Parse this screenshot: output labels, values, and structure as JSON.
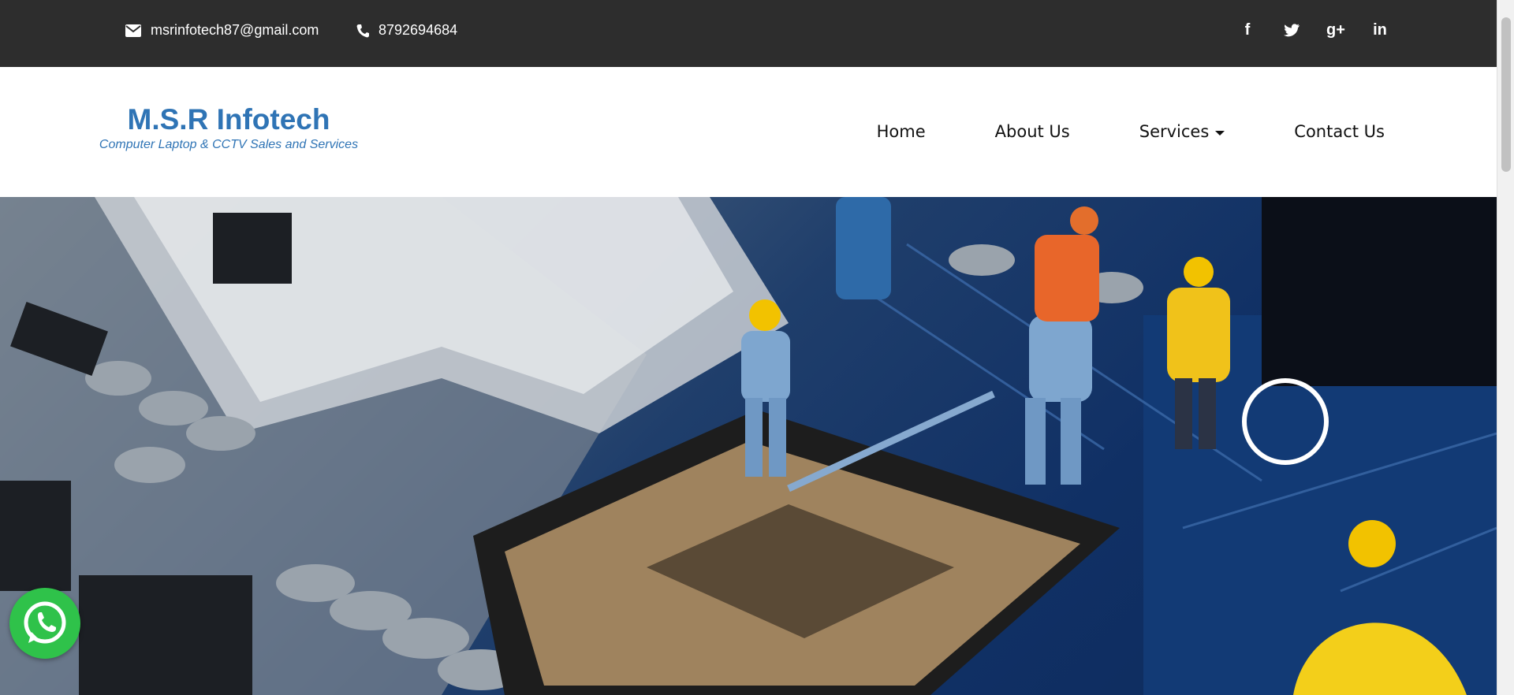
{
  "topbar": {
    "email": "msrinfotech87@gmail.com",
    "phone": "8792694684",
    "social": [
      {
        "icon": "facebook-icon",
        "glyph": "f"
      },
      {
        "icon": "twitter-icon",
        "glyph": "🐦"
      },
      {
        "icon": "google-plus-icon",
        "glyph": "g+"
      },
      {
        "icon": "linkedin-icon",
        "glyph": "in"
      }
    ]
  },
  "brand": {
    "name": "M.S.R Infotech",
    "tagline": "Computer Laptop & CCTV Sales and Services"
  },
  "nav": {
    "home": "Home",
    "about": "About Us",
    "services": "Services",
    "contact": "Contact Us"
  },
  "colors": {
    "topbar_bg": "#2d2d2d",
    "brand": "#2f74b5",
    "whatsapp": "#2fc24a"
  },
  "floating": {
    "icon": "whatsapp-icon"
  }
}
